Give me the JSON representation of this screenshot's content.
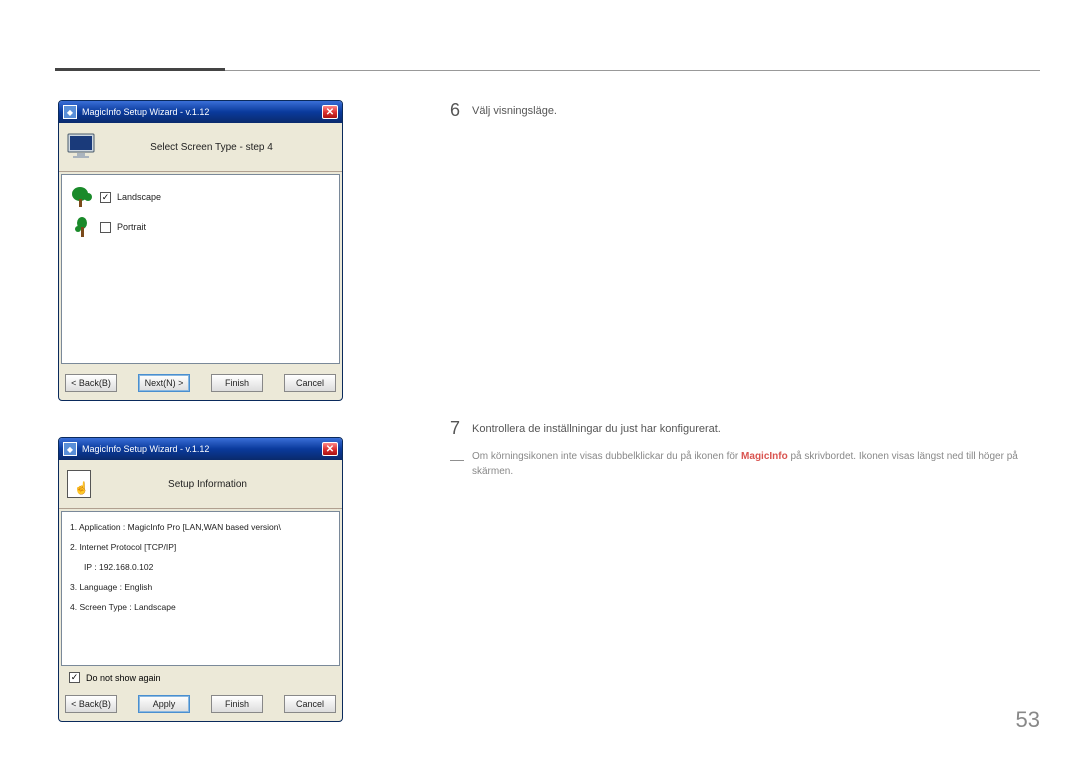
{
  "page_number": "53",
  "step6": {
    "num": "6",
    "text": "Välj visningsläge."
  },
  "step7": {
    "num": "7",
    "text": "Kontrollera de inställningar du just har konfigurerat."
  },
  "note": {
    "dash": "―",
    "pre": "Om körningsikonen inte visas dubbelklickar du på ikonen för ",
    "highlight": "MagicInfo",
    "post": " på skrivbordet. Ikonen visas längst ned till höger på skärmen."
  },
  "wizard1": {
    "title": "MagicInfo Setup Wizard - v.1.12",
    "header": "Select Screen Type - step 4",
    "landscape": {
      "label": "Landscape",
      "checked": "✓"
    },
    "portrait": {
      "label": "Portrait",
      "checked": ""
    },
    "buttons": {
      "back": "< Back(B)",
      "next": "Next(N) >",
      "finish": "Finish",
      "cancel": "Cancel"
    }
  },
  "wizard2": {
    "title": "MagicInfo Setup Wizard - v.1.12",
    "header": "Setup Information",
    "lines": {
      "l1": "1. Application :    MagicInfo Pro [LAN,WAN based version\\",
      "l2": "2. Internet Protocol [TCP/IP]",
      "ip": "IP :      192.168.0.102",
      "l3": "3. Language :    English",
      "l4": "4. Screen Type :    Landscape"
    },
    "dont_show": {
      "label": "Do not show again",
      "checked": "✓"
    },
    "buttons": {
      "back": "< Back(B)",
      "apply": "Apply",
      "finish": "Finish",
      "cancel": "Cancel"
    }
  }
}
